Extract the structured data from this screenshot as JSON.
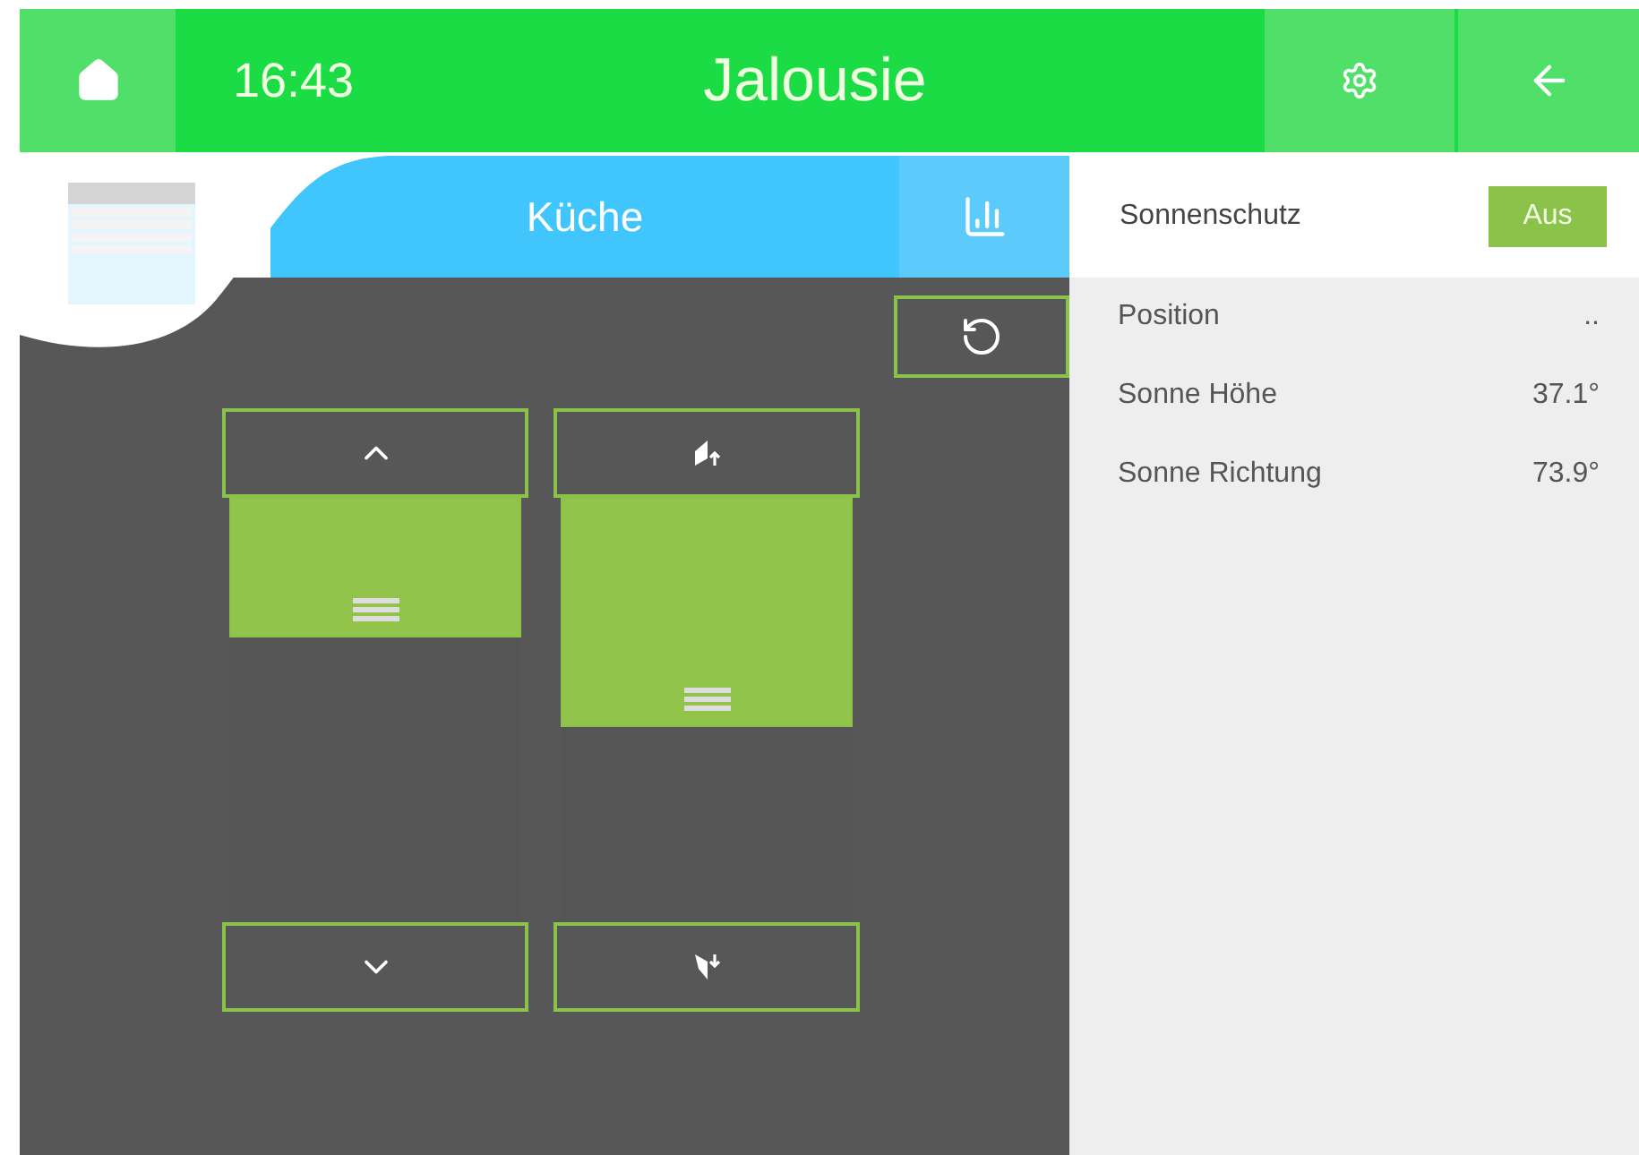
{
  "header": {
    "time": "16:43",
    "title": "Jalousie"
  },
  "room": {
    "name": "Küche"
  },
  "sliders": [
    {
      "kind": "height",
      "level": 0.33
    },
    {
      "kind": "slat",
      "level": 0.54
    }
  ],
  "side_panel": {
    "sonnenschutz": {
      "label": "Sonnenschutz",
      "button": "Aus",
      "on": false
    },
    "rows": [
      {
        "label": "Position",
        "value": ".."
      },
      {
        "label": "Sonne Höhe",
        "value": "37.1°"
      },
      {
        "label": "Sonne Richtung",
        "value": "73.9°"
      }
    ]
  }
}
